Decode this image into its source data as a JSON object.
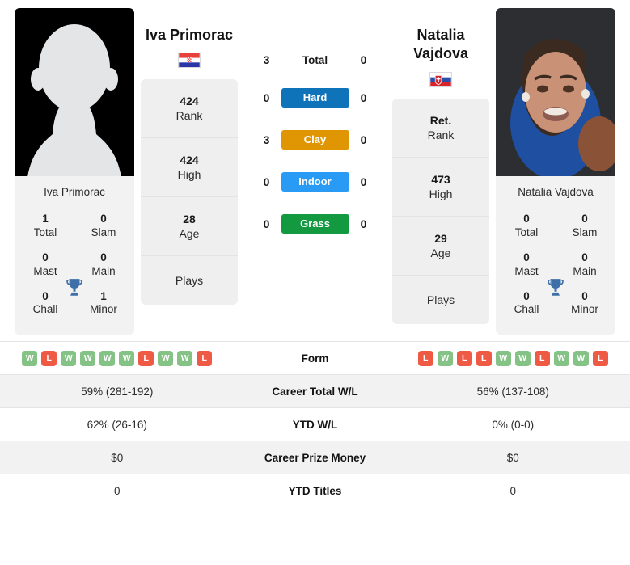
{
  "players": {
    "left": {
      "name": "Iva Primorac",
      "card_name": "Iva Primorac",
      "country": "Croatia",
      "photo_type": "placeholder-silhouette",
      "titles": {
        "total_value": "1",
        "total_label": "Total",
        "slam_value": "0",
        "slam_label": "Slam",
        "mast_value": "0",
        "mast_label": "Mast",
        "main_value": "0",
        "main_label": "Main",
        "chall_value": "0",
        "chall_label": "Chall",
        "minor_value": "1",
        "minor_label": "Minor"
      },
      "stats": {
        "rank_value": "424",
        "rank_label": "Rank",
        "high_value": "424",
        "high_label": "High",
        "age_value": "28",
        "age_label": "Age",
        "plays_label": "Plays"
      },
      "surface_wins": {
        "total": "3",
        "hard": "0",
        "clay": "3",
        "indoor": "0",
        "grass": "0"
      },
      "form": [
        "W",
        "L",
        "W",
        "W",
        "W",
        "W",
        "L",
        "W",
        "W",
        "L"
      ],
      "career_total_wl": "59% (281-192)",
      "ytd_wl": "62% (26-16)",
      "career_prize_money": "$0",
      "ytd_titles": "0"
    },
    "right": {
      "name": "Natalia Vajdova",
      "card_name": "Natalia Vajdova",
      "country": "Slovakia",
      "photo_type": "portrait",
      "titles": {
        "total_value": "0",
        "total_label": "Total",
        "slam_value": "0",
        "slam_label": "Slam",
        "mast_value": "0",
        "mast_label": "Mast",
        "main_value": "0",
        "main_label": "Main",
        "chall_value": "0",
        "chall_label": "Chall",
        "minor_value": "0",
        "minor_label": "Minor"
      },
      "stats": {
        "rank_value": "Ret.",
        "rank_label": "Rank",
        "high_value": "473",
        "high_label": "High",
        "age_value": "29",
        "age_label": "Age",
        "plays_label": "Plays"
      },
      "surface_wins": {
        "total": "0",
        "hard": "0",
        "clay": "0",
        "indoor": "0",
        "grass": "0"
      },
      "form": [
        "L",
        "W",
        "L",
        "L",
        "W",
        "W",
        "L",
        "W",
        "W",
        "L"
      ],
      "career_total_wl": "56% (137-108)",
      "ytd_wl": "0% (0-0)",
      "career_prize_money": "$0",
      "ytd_titles": "0"
    }
  },
  "surfaces": [
    {
      "key": "total",
      "label": "Total",
      "color": "#ffffff",
      "text_color": "#1a1a1a",
      "plain": true
    },
    {
      "key": "hard",
      "label": "Hard",
      "color": "#0f73ba",
      "text_color": "#ffffff",
      "plain": false
    },
    {
      "key": "clay",
      "label": "Clay",
      "color": "#e09503",
      "text_color": "#ffffff",
      "plain": false
    },
    {
      "key": "indoor",
      "label": "Indoor",
      "color": "#2a9bf5",
      "text_color": "#ffffff",
      "plain": false
    },
    {
      "key": "grass",
      "label": "Grass",
      "color": "#139a41",
      "text_color": "#ffffff",
      "plain": false
    }
  ],
  "table_rows": [
    {
      "label": "Form",
      "type": "form"
    },
    {
      "label": "Career Total W/L",
      "type": "text",
      "field": "career_total_wl"
    },
    {
      "label": "YTD W/L",
      "type": "text",
      "field": "ytd_wl"
    },
    {
      "label": "Career Prize Money",
      "type": "text",
      "field": "career_prize_money"
    },
    {
      "label": "YTD Titles",
      "type": "text",
      "field": "ytd_titles"
    }
  ],
  "colors": {
    "card_bg": "#efefef",
    "alt_row_bg": "#f2f2f2",
    "trophy": "#3f6fa8",
    "win": "#85c285",
    "loss": "#ef5a45"
  }
}
